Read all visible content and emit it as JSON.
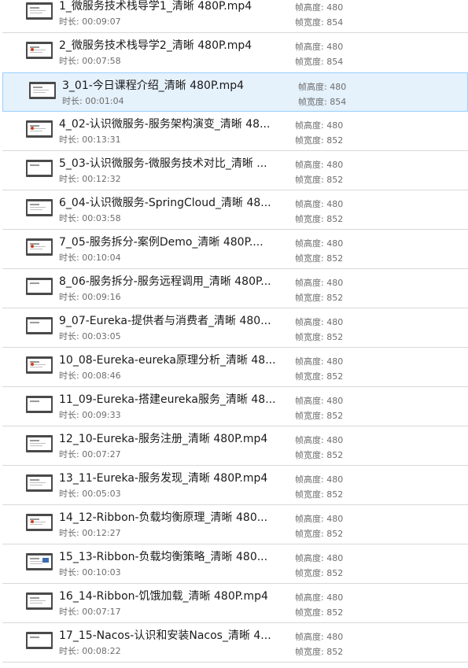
{
  "labels": {
    "duration_prefix": "时长: ",
    "frame_height_prefix": "帧高度: ",
    "frame_width_prefix": "帧宽度: "
  },
  "files": [
    {
      "name": "1_微服务技术栈导学1_清晰 480P.mp4",
      "duration": "00:09:07",
      "frame_height": "480",
      "frame_width": "854",
      "selected": false,
      "thumb": "v1"
    },
    {
      "name": "2_微服务技术栈导学2_清晰 480P.mp4",
      "duration": "00:07:58",
      "frame_height": "480",
      "frame_width": "854",
      "selected": false,
      "thumb": "v2"
    },
    {
      "name": "3_01-今日课程介绍_清晰 480P.mp4",
      "duration": "00:01:04",
      "frame_height": "480",
      "frame_width": "854",
      "selected": true,
      "thumb": "v1"
    },
    {
      "name": "4_02-认识微服务-服务架构演变_清晰 48...",
      "duration": "00:13:31",
      "frame_height": "480",
      "frame_width": "852",
      "selected": false,
      "thumb": "v2"
    },
    {
      "name": "5_03-认识微服务-微服务技术对比_清晰 ...",
      "duration": "00:12:32",
      "frame_height": "480",
      "frame_width": "852",
      "selected": false,
      "thumb": "v4"
    },
    {
      "name": "6_04-认识微服务-SpringCloud_清晰 48...",
      "duration": "00:03:58",
      "frame_height": "480",
      "frame_width": "852",
      "selected": false,
      "thumb": "v1"
    },
    {
      "name": "7_05-服务拆分-案例Demo_清晰 480P....",
      "duration": "00:10:04",
      "frame_height": "480",
      "frame_width": "852",
      "selected": false,
      "thumb": "v2"
    },
    {
      "name": "8_06-服务拆分-服务远程调用_清晰 480P...",
      "duration": "00:09:16",
      "frame_height": "480",
      "frame_width": "852",
      "selected": false,
      "thumb": "v4"
    },
    {
      "name": "9_07-Eureka-提供者与消费者_清晰 480...",
      "duration": "00:03:05",
      "frame_height": "480",
      "frame_width": "852",
      "selected": false,
      "thumb": "v4"
    },
    {
      "name": "10_08-Eureka-eureka原理分析_清晰 48...",
      "duration": "00:08:46",
      "frame_height": "480",
      "frame_width": "852",
      "selected": false,
      "thumb": "v2"
    },
    {
      "name": "11_09-Eureka-搭建eureka服务_清晰 48...",
      "duration": "00:09:33",
      "frame_height": "480",
      "frame_width": "852",
      "selected": false,
      "thumb": "v4"
    },
    {
      "name": "12_10-Eureka-服务注册_清晰 480P.mp4",
      "duration": "00:07:27",
      "frame_height": "480",
      "frame_width": "852",
      "selected": false,
      "thumb": "v1"
    },
    {
      "name": "13_11-Eureka-服务发现_清晰 480P.mp4",
      "duration": "00:05:03",
      "frame_height": "480",
      "frame_width": "852",
      "selected": false,
      "thumb": "v1"
    },
    {
      "name": "14_12-Ribbon-负载均衡原理_清晰 480...",
      "duration": "00:12:27",
      "frame_height": "480",
      "frame_width": "852",
      "selected": false,
      "thumb": "v2"
    },
    {
      "name": "15_13-Ribbon-负载均衡策略_清晰 480...",
      "duration": "00:10:03",
      "frame_height": "480",
      "frame_width": "852",
      "selected": false,
      "thumb": "v3"
    },
    {
      "name": "16_14-Ribbon-饥饿加载_清晰 480P.mp4",
      "duration": "00:07:17",
      "frame_height": "480",
      "frame_width": "852",
      "selected": false,
      "thumb": "v1"
    },
    {
      "name": "17_15-Nacos-认识和安装Nacos_清晰 4...",
      "duration": "00:08:22",
      "frame_height": "480",
      "frame_width": "852",
      "selected": false,
      "thumb": "v4"
    }
  ]
}
